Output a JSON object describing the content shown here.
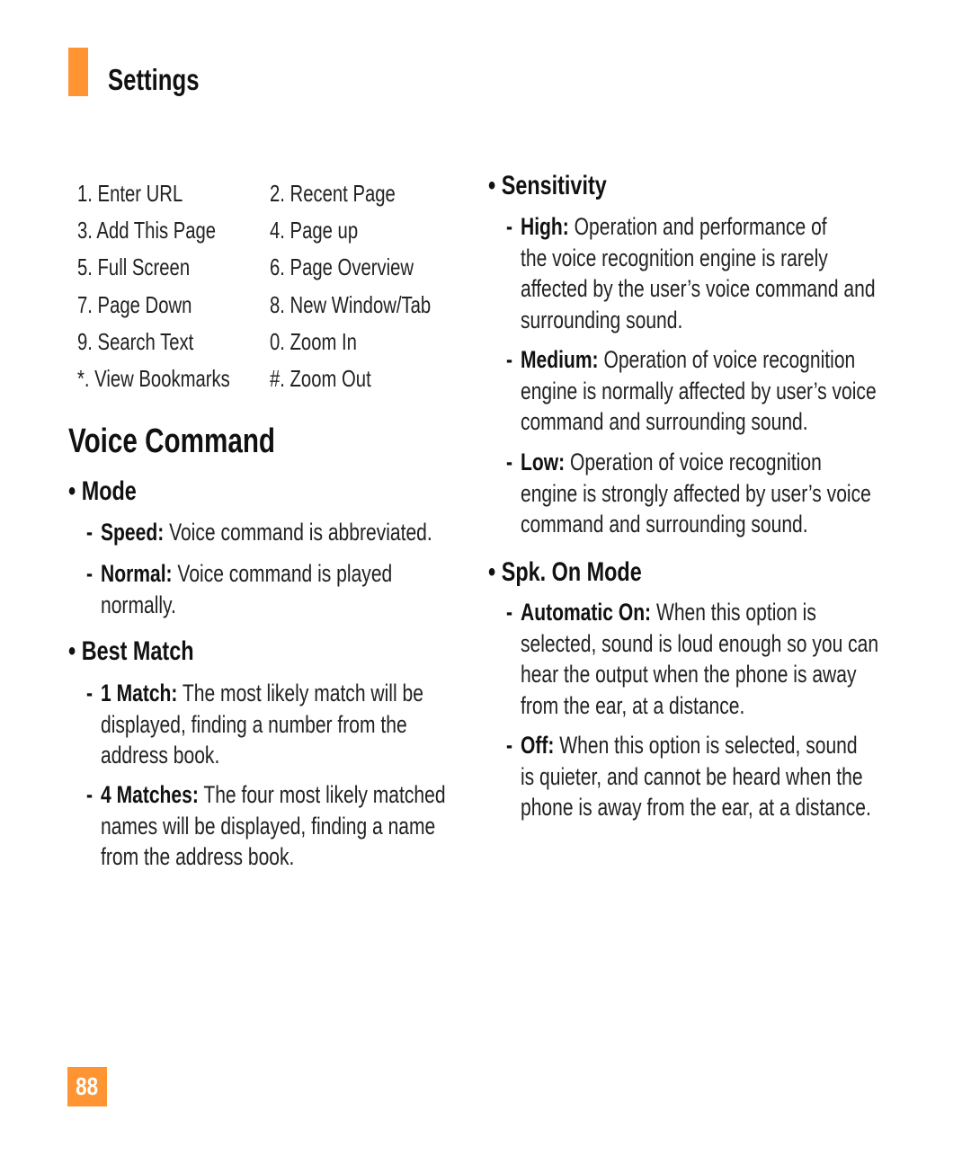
{
  "section": {
    "title": "Settings",
    "accent_color": "#ff9433"
  },
  "shortcuts": [
    [
      "1. Enter URL",
      "2. Recent Page"
    ],
    [
      "3. Add This Page",
      "4. Page up"
    ],
    [
      "5. Full Screen",
      "6. Page Overview"
    ],
    [
      "7. Page Down",
      "8. New Window/Tab"
    ],
    [
      "9. Search Text",
      "0. Zoom In"
    ],
    [
      "*. View Bookmarks",
      "#. Zoom Out"
    ]
  ],
  "heading": "Voice Command",
  "bullet_char": "•",
  "dash_char": "-",
  "left_column": {
    "mode": {
      "title": "Mode",
      "items": [
        {
          "label": "Speed:",
          "lines": [
            "Voice command is abbreviated."
          ]
        },
        {
          "label": "Normal:",
          "lines": [
            "Voice command is played",
            "normally."
          ]
        }
      ]
    },
    "best_match": {
      "title": "Best Match",
      "items": [
        {
          "label": "1 Match:",
          "lines": [
            "The most likely match will be",
            "displayed, finding a number from the",
            "address book."
          ]
        },
        {
          "label": "4 Matches:",
          "lines": [
            "The four most likely matched",
            "names will be displayed, finding a name",
            "from the address book."
          ]
        }
      ]
    }
  },
  "right_column": {
    "sensitivity": {
      "title": "Sensitivity",
      "items": [
        {
          "label": "High:",
          "lines": [
            "Operation and performance of",
            "the voice recognition engine is rarely",
            "affected by the user’s voice command and",
            "surrounding sound."
          ]
        },
        {
          "label": "Medium:",
          "lines": [
            "Operation of voice recognition",
            "engine is normally affected by user’s voice",
            "command and surrounding sound."
          ]
        },
        {
          "label": "Low:",
          "lines": [
            "Operation of voice recognition",
            "engine is strongly affected by user’s voice",
            "command and surrounding sound."
          ]
        }
      ]
    },
    "spk_on_mode": {
      "title": "Spk. On Mode",
      "items": [
        {
          "label": "Automatic On:",
          "lines": [
            "When this option is",
            "selected, sound is loud enough so you can",
            "hear the output when the phone is away",
            "from the ear, at a distance."
          ]
        },
        {
          "label": "Off:",
          "lines": [
            "When this option is selected, sound",
            "is quieter, and cannot be heard when the",
            "phone is away from the ear, at a distance."
          ]
        }
      ]
    }
  },
  "page_number": "88"
}
